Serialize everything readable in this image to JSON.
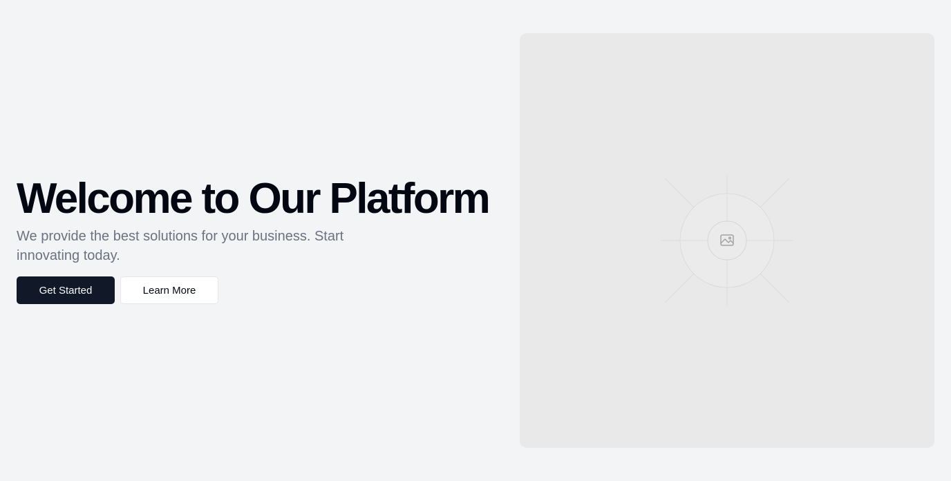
{
  "hero": {
    "title": "Welcome to Our Platform",
    "subtitle": "We provide the best solutions for your business. Start innovating today.",
    "primary_button_label": "Get Started",
    "secondary_button_label": "Learn More"
  },
  "media": {
    "placeholder_icon": "image-icon"
  },
  "colors": {
    "background": "#f3f4f6",
    "primary_button": "#111827",
    "title_text": "#030712",
    "subtitle_text": "#6b7280",
    "placeholder_panel": "#e9e9ea"
  }
}
